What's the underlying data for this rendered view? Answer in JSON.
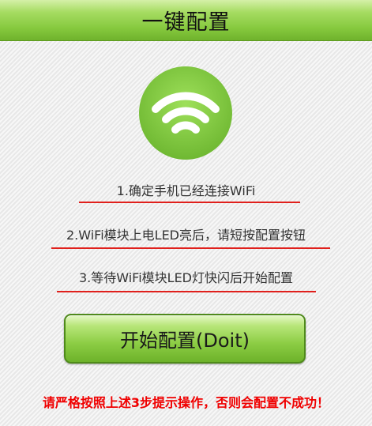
{
  "header": {
    "title": "一键配置"
  },
  "status_icon": {
    "icon": "wifi-icon",
    "color": "#7cc540"
  },
  "steps": [
    {
      "text": "1.确定手机已经连接WiFi"
    },
    {
      "text": "2.WiFi模块上电LED亮后，请短按配置按钮"
    },
    {
      "text": "3.等待WiFi模块LED灯快闪后开始配置"
    }
  ],
  "actions": {
    "start_label": "开始配置(Doit)"
  },
  "warning": {
    "text": "请严格按照上述3步提示操作，否则会配置不成功！",
    "color": "#f00000"
  },
  "colors": {
    "accent": "#86c93e",
    "underline": "#e0201c"
  }
}
